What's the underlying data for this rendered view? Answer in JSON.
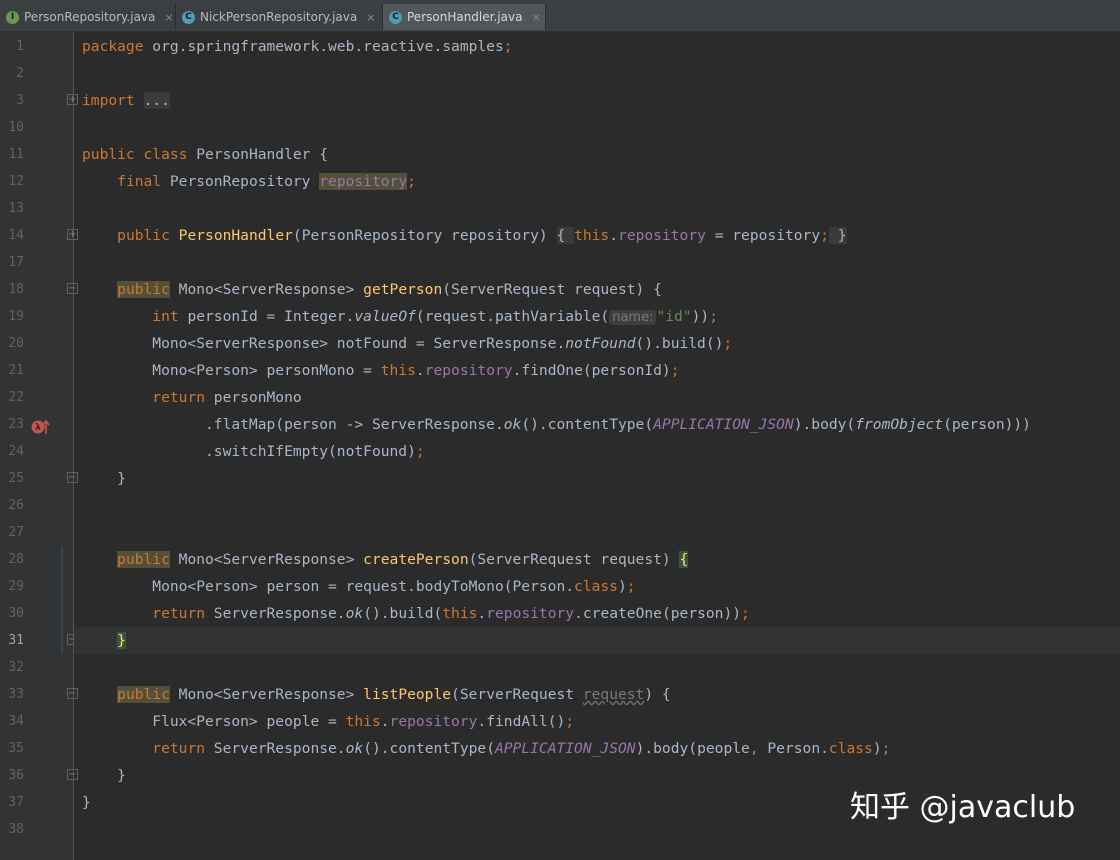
{
  "tabs": [
    {
      "label": "PersonRepository.java",
      "icon": "interface-icon",
      "icon_color": "#6a9955",
      "letter": "I",
      "active": false
    },
    {
      "label": "NickPersonRepository.java",
      "icon": "class-icon",
      "icon_color": "#4e9bb6",
      "letter": "C",
      "active": false
    },
    {
      "label": "PersonHandler.java",
      "icon": "class-icon",
      "icon_color": "#4e9bb6",
      "letter": "C",
      "active": true
    }
  ],
  "close_glyph": "×",
  "fold_glyphs": {
    "expand": "+",
    "collapse": "−"
  },
  "line_numbers": [
    "1",
    "2",
    "3",
    "10",
    "11",
    "12",
    "13",
    "14",
    "17",
    "18",
    "19",
    "20",
    "21",
    "22",
    "23",
    "24",
    "25",
    "26",
    "27",
    "28",
    "29",
    "30",
    "31",
    "32",
    "33",
    "34",
    "35",
    "36",
    "37",
    "38"
  ],
  "current_line": "31",
  "code": {
    "l1": [
      "package",
      " org.springframework.web.reactive.samples",
      ";"
    ],
    "l3": [
      "import",
      " ",
      "..."
    ],
    "l11": [
      "public class",
      " PersonHandler {"
    ],
    "l12": [
      "    ",
      "final",
      " PersonRepository ",
      "repository",
      ";"
    ],
    "l14": [
      "    ",
      "public",
      " ",
      "PersonHandler",
      "(PersonRepository repository) ",
      "{ ",
      "this",
      ".",
      "repository",
      " = repository",
      ";",
      " }"
    ],
    "l18": [
      "    ",
      "public",
      " Mono<ServerResponse> ",
      "getPerson",
      "(ServerRequest request) {"
    ],
    "l19": [
      "        ",
      "int",
      " personId = Integer.",
      "valueOf",
      "(request.pathVariable(",
      "name:",
      "\"id\"",
      "))",
      ";"
    ],
    "l20": [
      "        Mono<ServerResponse> notFound = ServerResponse.",
      "notFound",
      "().build()",
      ";"
    ],
    "l21": [
      "        Mono<Person> personMono = ",
      "this",
      ".",
      "repository",
      ".findOne(personId)",
      ";"
    ],
    "l22": [
      "        ",
      "return",
      " personMono"
    ],
    "l23": [
      "              .flatMap(person -> ServerResponse.",
      "ok",
      "().contentType(",
      "APPLICATION_JSON",
      ").body(",
      "fromObject",
      "(person)))"
    ],
    "l24": [
      "              .switchIfEmpty(notFound)",
      ";"
    ],
    "l25": [
      "    }"
    ],
    "l28": [
      "    ",
      "public",
      " Mono<ServerResponse> ",
      "createPerson",
      "(ServerRequest request) ",
      "{"
    ],
    "l29": [
      "        Mono<Person> person = request.bodyToMono(Person.",
      "class",
      ")",
      ";"
    ],
    "l30": [
      "        ",
      "return",
      " ServerResponse.",
      "ok",
      "().build(",
      "this",
      ".",
      "repository",
      ".createOne(person))",
      ";"
    ],
    "l31": [
      "    ",
      "}"
    ],
    "l33": [
      "    ",
      "public",
      " Mono<ServerResponse> ",
      "listPeople",
      "(ServerRequest ",
      "request",
      ") {"
    ],
    "l34": [
      "        Flux<Person> people = ",
      "this",
      ".",
      "repository",
      ".findAll()",
      ";"
    ],
    "l35": [
      "        ",
      "return",
      " ServerResponse.",
      "ok",
      "().contentType(",
      "APPLICATION_JSON",
      ").body(people",
      ",",
      " Person.",
      "class",
      ")",
      ";"
    ],
    "l36": [
      "    }"
    ],
    "l37": [
      "}"
    ]
  },
  "gutter_icon": {
    "name": "override-lambda-icon",
    "color": "#c75450"
  },
  "watermark": "知乎 @javaclub"
}
